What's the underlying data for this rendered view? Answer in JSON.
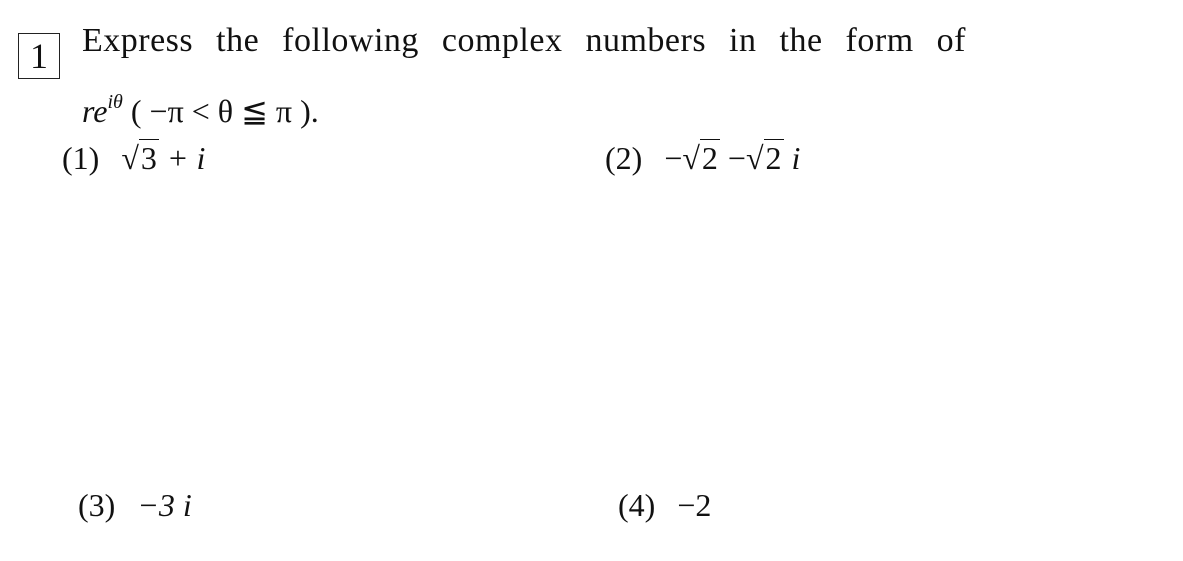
{
  "problem": {
    "number": "1",
    "instruction": "Express the following complex numbers in the form of",
    "form_base": "re",
    "form_exponent": "iθ",
    "form_condition": "( −π < θ ≦ π ).",
    "items": [
      {
        "label": "(1)",
        "radical_sign": "√",
        "radicand": "3",
        "rest": "+ i"
      },
      {
        "label": "(2)",
        "prefix": "−",
        "radical_sign": "√",
        "radicand": "2",
        "mid": "−",
        "radicand2": "2",
        "rest": "i"
      },
      {
        "label": "(3)",
        "expr": "−3 i"
      },
      {
        "label": "(4)",
        "expr": "−2"
      }
    ]
  }
}
